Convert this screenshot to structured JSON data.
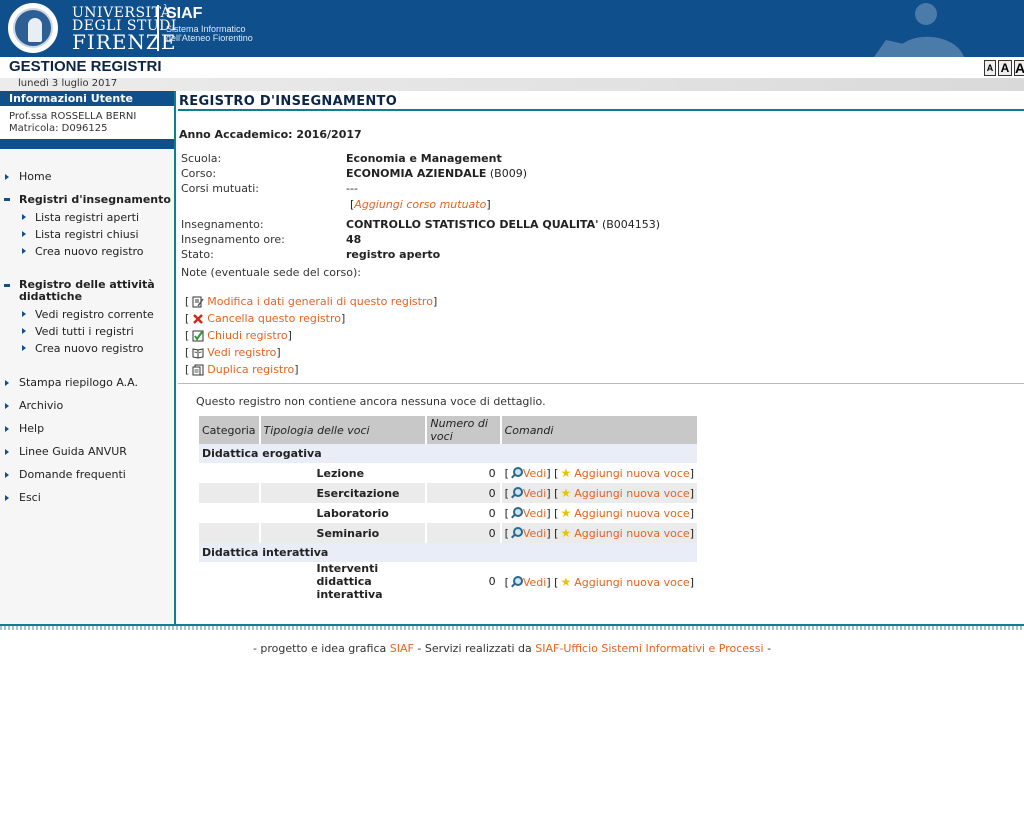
{
  "header": {
    "university_line1": "UNIVERSITÀ",
    "university_line2": "DEGLI STUDI",
    "university_line3": "FIRENZE",
    "siaf_title": "SIAF",
    "siaf_sub1": "Sistema Informatico",
    "siaf_sub2": "dell'Ateneo Fiorentino"
  },
  "app": {
    "title": "GESTIONE REGISTRI",
    "date": "lunedì 3 luglio 2017",
    "font_sizes": [
      "A",
      "A",
      "A"
    ]
  },
  "sidebar": {
    "user_heading": "Informazioni Utente",
    "user_name": "Prof.ssa ROSSELLA BERNI",
    "user_matricola": "Matricola: D096125",
    "home": "Home",
    "registri_insegnamento": "Registri d'insegnamento",
    "registri_insegnamento_items": [
      "Lista registri aperti",
      "Lista registri chiusi",
      "Crea nuovo registro"
    ],
    "registro_attivita": "Registro delle attività didattiche",
    "registro_attivita_items": [
      "Vedi registro corrente",
      "Vedi tutti i registri",
      "Crea nuovo registro"
    ],
    "bottom_items": [
      "Stampa riepilogo A.A.",
      "Archivio",
      "Help",
      "Linee Guida ANVUR",
      "Domande frequenti",
      "Esci"
    ]
  },
  "main": {
    "title": "REGISTRO D'INSEGNAMENTO",
    "anno": "Anno Accademico: 2016/2017",
    "scuola_label": "Scuola:",
    "scuola_value": "Economia e Management",
    "corso_label": "Corso:",
    "corso_value": "ECONOMIA AZIENDALE",
    "corso_code": "(B009)",
    "mutuati_label": "Corsi mutuati:",
    "mutuati_value": "---",
    "aggiungi_mutuato": "Aggiungi corso mutuato",
    "insegnamento_label": "Insegnamento:",
    "insegnamento_value": "CONTROLLO STATISTICO DELLA QUALITA'",
    "insegnamento_code": "(B004153)",
    "ore_label": "Insegnamento ore:",
    "ore_value": "48",
    "stato_label": "Stato:",
    "stato_value": "registro aperto",
    "note_label": "Note (eventuale sede del corso):",
    "actions": {
      "modifica": "Modifica i dati generali di questo registro",
      "cancella": "Cancella questo registro",
      "chiudi": "Chiudi registro",
      "vedi": "Vedi registro",
      "duplica": "Duplica registro"
    },
    "empty_message": "Questo registro non contiene ancora nessuna voce di dettaglio."
  },
  "table": {
    "headers": {
      "categoria": "Categoria",
      "tipologia": "Tipologia delle voci",
      "numero": "Numero di voci",
      "comandi": "Comandi"
    },
    "groups": [
      {
        "name": "Didattica erogativa",
        "rows": [
          {
            "tipologia": "Lezione",
            "numero": "0"
          },
          {
            "tipologia": "Esercitazione",
            "numero": "0"
          },
          {
            "tipologia": "Laboratorio",
            "numero": "0"
          },
          {
            "tipologia": "Seminario",
            "numero": "0"
          }
        ]
      },
      {
        "name": "Didattica interattiva",
        "rows": [
          {
            "tipologia": "Interventi didattica interattiva",
            "numero": "0"
          }
        ]
      }
    ],
    "cmd_vedi": "Vedi",
    "cmd_aggiungi": "Aggiungi nuova voce"
  },
  "footer": {
    "part1": "- progetto e idea grafica",
    "siaf": "SIAF",
    "part2": "- Servizi realizzati da",
    "ufficio": "SIAF-Ufficio Sistemi Informativi e Processi",
    "part3": "-"
  }
}
